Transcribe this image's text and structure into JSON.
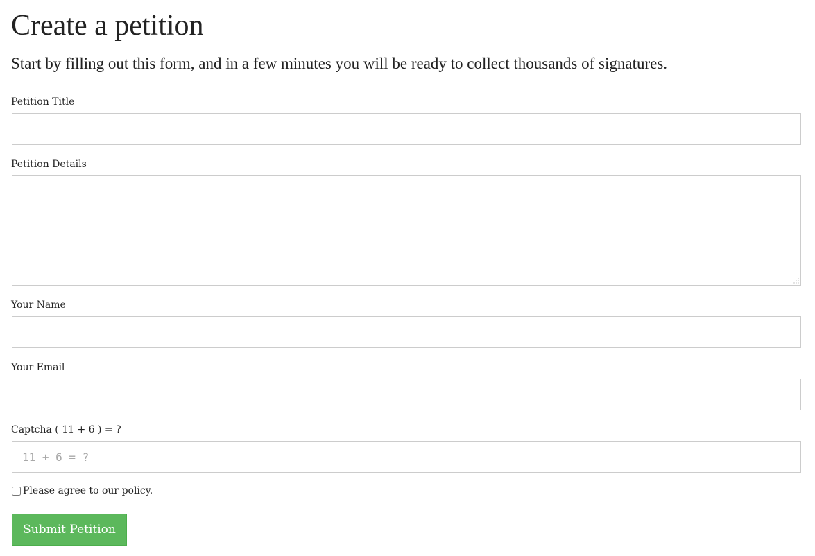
{
  "header": {
    "title": "Create a petition",
    "subtitle": "Start by filling out this form, and in a few minutes you will be ready to collect thousands of signatures."
  },
  "form": {
    "petition_title": {
      "label": "Petition Title",
      "value": "",
      "placeholder": ""
    },
    "petition_details": {
      "label": "Petition Details",
      "value": "",
      "placeholder": ""
    },
    "your_name": {
      "label": "Your Name",
      "value": "",
      "placeholder": ""
    },
    "your_email": {
      "label": "Your Email",
      "value": "",
      "placeholder": ""
    },
    "captcha": {
      "label": "Captcha ( 11 + 6 ) = ?",
      "value": "",
      "placeholder": "11 + 6 = ?"
    },
    "agree": {
      "label": "Please agree to our policy.",
      "checked": false
    },
    "submit_label": "Submit Petition"
  },
  "colors": {
    "submit_bg": "#5cb85c",
    "field_border": "#cccccc",
    "text": "#222222"
  }
}
